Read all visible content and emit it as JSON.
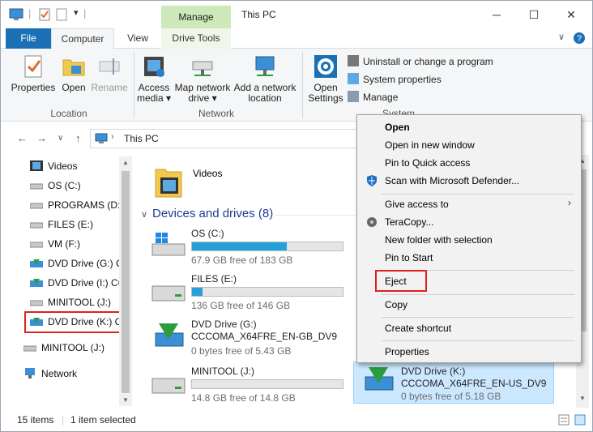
{
  "window": {
    "title": "This PC",
    "context_tab": "Manage",
    "minimize": "─",
    "maximize": "☐",
    "close": "✕"
  },
  "ribbon_tabs": {
    "file": "File",
    "computer": "Computer",
    "view": "View",
    "drive_tools": "Drive Tools"
  },
  "ribbon": {
    "location": {
      "label": "Location",
      "properties": "Properties",
      "open": "Open",
      "rename": "Rename"
    },
    "network": {
      "label": "Network",
      "access_media": "Access media",
      "map_network_drive": "Map network drive",
      "add_network_location": "Add a network location"
    },
    "system": {
      "label": "System",
      "open_settings": "Open Settings",
      "uninstall": "Uninstall or change a program",
      "system_properties": "System properties",
      "manage": "Manage"
    }
  },
  "address": {
    "path": "This PC"
  },
  "nav_pane": {
    "items": [
      {
        "label": "Videos"
      },
      {
        "label": "OS (C:)"
      },
      {
        "label": "PROGRAMS (D:)"
      },
      {
        "label": "FILES (E:)"
      },
      {
        "label": "VM (F:)"
      },
      {
        "label": "DVD Drive (G:) C"
      },
      {
        "label": "DVD Drive (I:) CC"
      },
      {
        "label": "MINITOOL (J:)"
      },
      {
        "label": "DVD Drive (K:) C"
      },
      {
        "label": "MINITOOL (J:)"
      },
      {
        "label": "Network"
      }
    ]
  },
  "content": {
    "folder_videos": "Videos",
    "section_title": "Devices and drives (8)",
    "drives": [
      {
        "name": "OS (C:)",
        "name2": "",
        "free": "67.9 GB free of 183 GB",
        "used_fraction": 0.63
      },
      {
        "name": "FILES (E:)",
        "name2": "",
        "free": "136 GB free of 146 GB",
        "used_fraction": 0.07
      },
      {
        "name": "DVD Drive (G:)",
        "name2": "CCCOMA_X64FRE_EN-GB_DV9",
        "free": "0 bytes free of 5.43 GB"
      },
      {
        "name": "MINITOOL (J:)",
        "name2": "",
        "free": "14.8 GB free of 14.8 GB",
        "used_fraction": 0.0
      },
      {
        "name": "DVD Drive (K:)",
        "name2": "CCCOMA_X64FRE_EN-US_DV9",
        "free": "0 bytes free of 5.18 GB"
      }
    ]
  },
  "status": {
    "count": "15 items",
    "selection": "1 item selected"
  },
  "context_menu": {
    "open": "Open",
    "open_new_window": "Open in new window",
    "pin_quick_access": "Pin to Quick access",
    "scan_defender": "Scan with Microsoft Defender...",
    "give_access": "Give access to",
    "teracopy": "TeraCopy...",
    "new_folder_selection": "New folder with selection",
    "pin_start": "Pin to Start",
    "eject": "Eject",
    "copy": "Copy",
    "create_shortcut": "Create shortcut",
    "properties": "Properties"
  },
  "colors": {
    "accent": "#1a6fb5",
    "manage_tab": "#cde8b9",
    "selection": "#cce8ff",
    "drive_bar": "#26a0da",
    "highlight_box": "#e02020",
    "section_heading": "#1e3d8f"
  }
}
